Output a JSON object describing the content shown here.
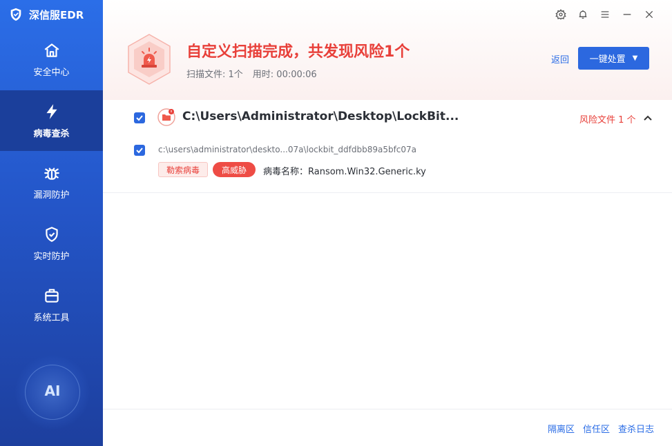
{
  "app": {
    "name": "深信服EDR"
  },
  "sidebar": {
    "items": [
      {
        "label": "安全中心",
        "icon": "home-icon",
        "active": false
      },
      {
        "label": "病毒查杀",
        "icon": "lightning-icon",
        "active": true
      },
      {
        "label": "漏洞防护",
        "icon": "bug-icon",
        "active": false
      },
      {
        "label": "实时防护",
        "icon": "shield-check-icon",
        "active": false
      },
      {
        "label": "系统工具",
        "icon": "toolbox-icon",
        "active": false
      }
    ],
    "ai_label": "AI"
  },
  "window_controls": [
    "settings-icon",
    "bell-icon",
    "menu-icon",
    "minimize-icon",
    "close-icon"
  ],
  "header": {
    "title": "自定义扫描完成，共发现风险1个",
    "files_label": "扫描文件: 1个",
    "time_label": "用时: 00:00:06",
    "back_label": "返回",
    "action_label": "一键处置"
  },
  "results": {
    "group_path": "C:\\Users\\Administrator\\Desktop\\LockBit...",
    "risk_count_label": "风险文件 1 个",
    "files": [
      {
        "path": "c:\\users\\administrator\\deskto...07a\\lockbit_ddfdbb89a5bfc07a",
        "type_tag": "勒索病毒",
        "level_tag": "高威胁",
        "virus_name": "病毒名称：Ransom.Win32.Generic.ky"
      }
    ]
  },
  "footer": {
    "quarantine_label": "隔离区",
    "trust_label": "信任区",
    "log_label": "查杀日志"
  },
  "colors": {
    "accent": "#2c68df",
    "danger": "#e8403a",
    "sidebar": "#2456c9"
  }
}
